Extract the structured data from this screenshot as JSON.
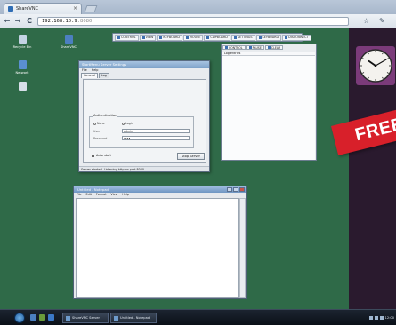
{
  "browser": {
    "tab_title": "ShareVNC",
    "tab_close": "×",
    "url_host": "192.168.10.9",
    "url_port": ":8080",
    "nav": {
      "back": "←",
      "forward": "→",
      "reload": "C"
    }
  },
  "server_toolbar": {
    "buttons": [
      "CONTROL",
      "VIEW",
      "KEYBOARD",
      "MOUSE",
      "CLIPBOARD",
      "SETTINGS",
      "KEYBOARD",
      "DISCONNECT"
    ]
  },
  "desktop_icons": [
    {
      "label": "Recycle Bin"
    },
    {
      "label": "ShareVNC"
    },
    {
      "label": "Network"
    }
  ],
  "settings_window": {
    "title": "StartMenu Server Settings",
    "menu": [
      "File",
      "Help"
    ],
    "tabs": [
      "General",
      "Log"
    ],
    "auth_group": "Authentication",
    "radio_none": "None",
    "radio_login": "Login",
    "user_label": "User",
    "user_value": "admin",
    "password_label": "Password",
    "password_value": "••••",
    "auto_start": "Auto start",
    "stop_button": "Stop Server",
    "status": "Server started. Listening http on port 8080"
  },
  "log_window": {
    "tabs": [
      "CONTROL",
      "PAUSE",
      "CLEAR"
    ],
    "header": "Log entries"
  },
  "editor_window": {
    "title": "Untitled - Notepad",
    "menu": [
      "File",
      "Edit",
      "Format",
      "View",
      "Help"
    ]
  },
  "clock": {
    "hour": 10,
    "minute": 10
  },
  "banner": {
    "text": "FREE"
  },
  "taskbar": {
    "tasks": [
      "ShareVNC Server",
      "Untitled - Notepad"
    ],
    "clock_text": "12:00"
  }
}
